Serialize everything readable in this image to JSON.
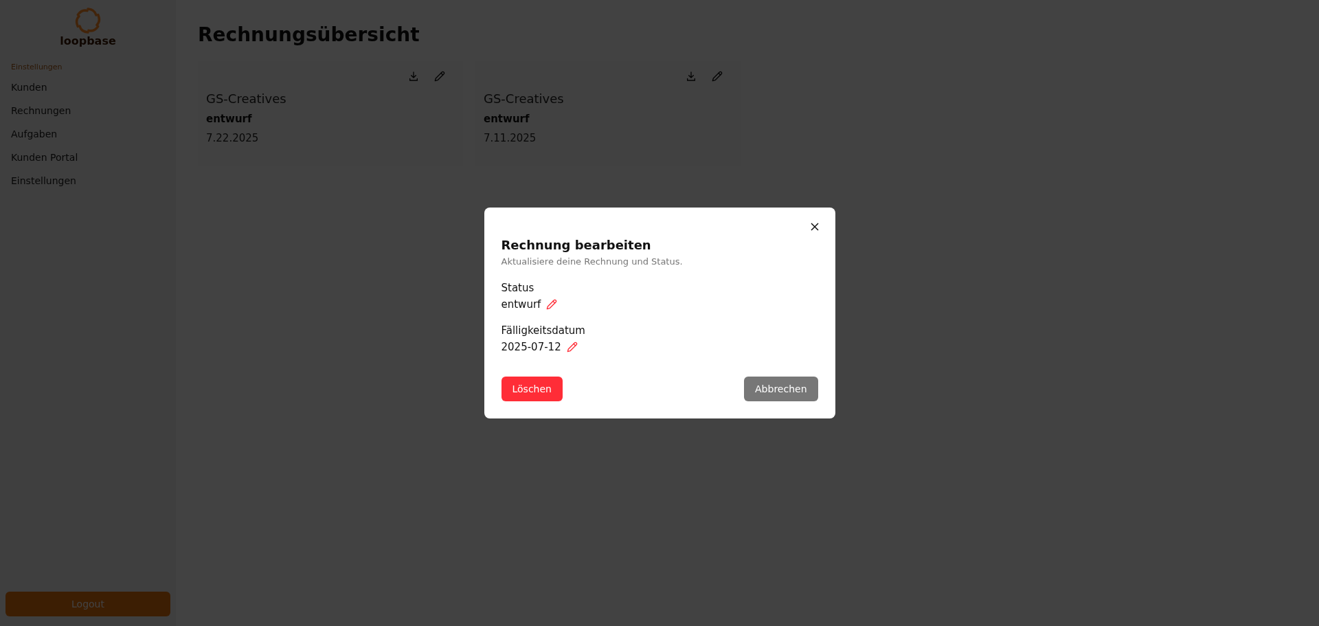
{
  "sidebar": {
    "logo_text": "loopbase",
    "section_label": "Einstellungen",
    "items": [
      {
        "label": "Kunden"
      },
      {
        "label": "Rechnungen"
      },
      {
        "label": "Aufgaben"
      },
      {
        "label": "Kunden Portal"
      },
      {
        "label": "Einstellungen"
      }
    ],
    "logout": "Logout"
  },
  "page": {
    "title": "Rechnungsübersicht"
  },
  "invoices": [
    {
      "customer": "GS-Creatives",
      "status": "entwurf",
      "date": "7.22.2025"
    },
    {
      "customer": "GS-Creatives",
      "status": "entwurf",
      "date": "7.11.2025"
    }
  ],
  "dialog": {
    "title": "Rechnung bearbeiten",
    "subtitle": "Aktualisiere deine Rechnung und Status.",
    "fields": [
      {
        "label": "Status",
        "value": "entwurf"
      },
      {
        "label": "Fälligkeitsdatum",
        "value": "2025-07-12"
      }
    ],
    "delete_button": "Löschen",
    "cancel_button": "Abbrechen"
  }
}
